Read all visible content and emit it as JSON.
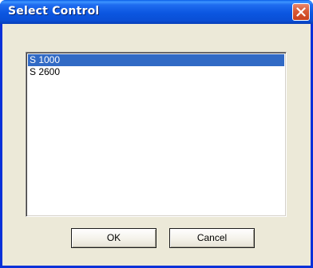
{
  "window": {
    "title": "Select Control",
    "close_icon": "close-icon"
  },
  "list": {
    "items": [
      {
        "label": "S 1000",
        "selected": true
      },
      {
        "label": "S 2600",
        "selected": false
      }
    ]
  },
  "buttons": {
    "ok_label": "OK",
    "cancel_label": "Cancel"
  },
  "colors": {
    "titlebar": "#0a4fd6",
    "selection": "#316ac5",
    "dialog_bg": "#ece9d8",
    "close_button": "#d85a35"
  }
}
